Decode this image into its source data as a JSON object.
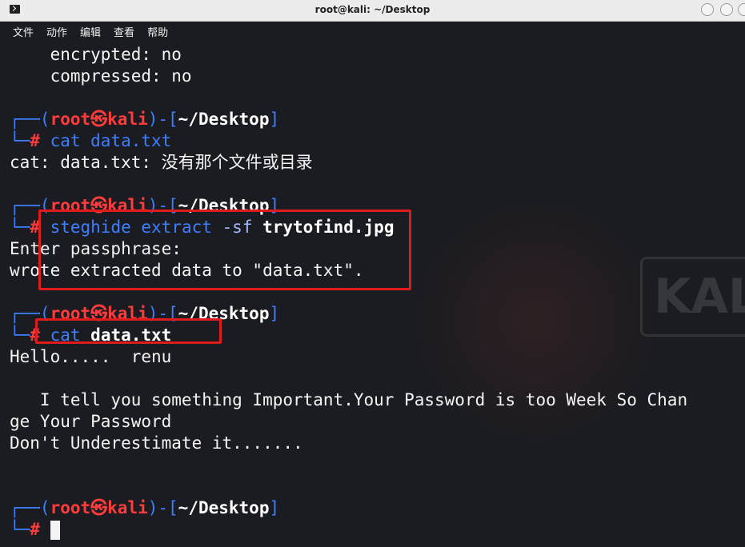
{
  "window": {
    "title": "root@kali: ~/Desktop"
  },
  "menu": [
    "文件",
    "动作",
    "编辑",
    "查看",
    "帮助"
  ],
  "prompt": {
    "open": "┌──(",
    "user": "root",
    "sep": "㉿",
    "host": "kali",
    "mid": ")-[",
    "path": "~/Desktop",
    "close": "]",
    "cmd_prefix": "└─",
    "hash": "#"
  },
  "lines": {
    "encrypted": "    encrypted: no",
    "compressed": "    compressed: no",
    "cmd1": " cat data.txt",
    "err1": "cat: data.txt: 没有那个文件或目录",
    "cmd2_a": " steghide extract ",
    "cmd2_b": "-sf",
    "cmd2_c": " trytofind.jpg",
    "passphrase": "Enter passphrase:",
    "wrote": "wrote extracted data to \"data.txt\".",
    "cmd3_a": " cat ",
    "cmd3_b": "data.txt",
    "hello": "Hello.....  renu",
    "important1": "   I tell you something Important.Your Password is too Week So Chan",
    "important2": "ge Your Password",
    "dont": "Don't Underestimate it......."
  },
  "colors": {
    "prompt_blue": "#3d7fff",
    "prompt_red": "#ff3b3b",
    "highlight_box": "#e01b1b",
    "background": "#1b1c21"
  }
}
